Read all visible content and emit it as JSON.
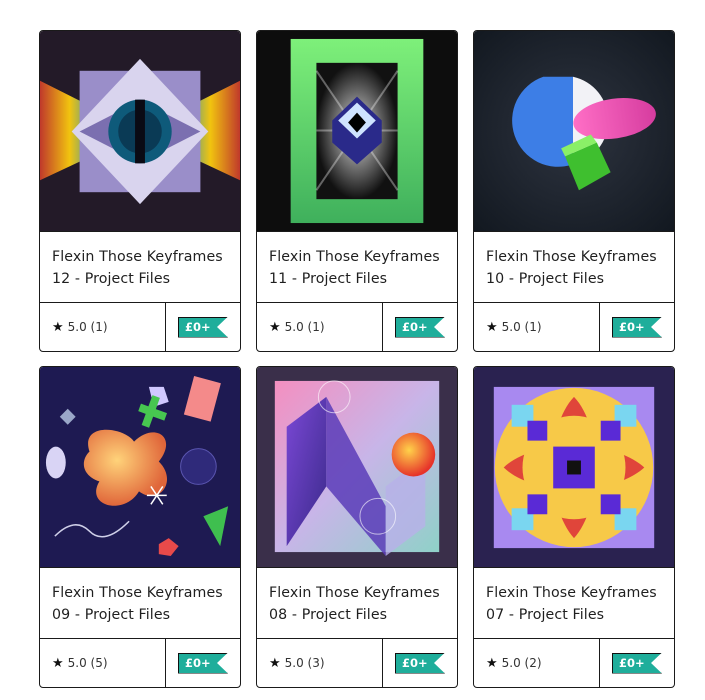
{
  "products": [
    {
      "title_line1": "Flexin Those Keyframes",
      "title_line2": "12 - Project Files",
      "rating": "5.0 (1)",
      "price": "£0+",
      "art": "eye-diamond-art"
    },
    {
      "title_line1": "Flexin Those Keyframes",
      "title_line2": "11 - Project Files",
      "rating": "5.0 (1)",
      "price": "£0+",
      "art": "green-frame-cube-art"
    },
    {
      "title_line1": "Flexin Those Keyframes",
      "title_line2": "10 - Project Files",
      "rating": "5.0 (1)",
      "price": "£0+",
      "art": "sphere-disc-cube-art"
    },
    {
      "title_line1": "Flexin Those Keyframes",
      "title_line2": "09 - Project Files",
      "rating": "5.0 (5)",
      "price": "£0+",
      "art": "shapes-blob-art"
    },
    {
      "title_line1": "Flexin Those Keyframes",
      "title_line2": "08 - Project Files",
      "rating": "5.0 (3)",
      "price": "£0+",
      "art": "gradient-n-art"
    },
    {
      "title_line1": "Flexin Those Keyframes",
      "title_line2": "07 - Project Files",
      "rating": "5.0 (2)",
      "price": "£0+",
      "art": "kaleidoscope-art"
    }
  ],
  "colors": {
    "price_tag": "#1fae9b",
    "border": "#1a1a1a"
  },
  "icons": {
    "rating": "star-icon"
  }
}
